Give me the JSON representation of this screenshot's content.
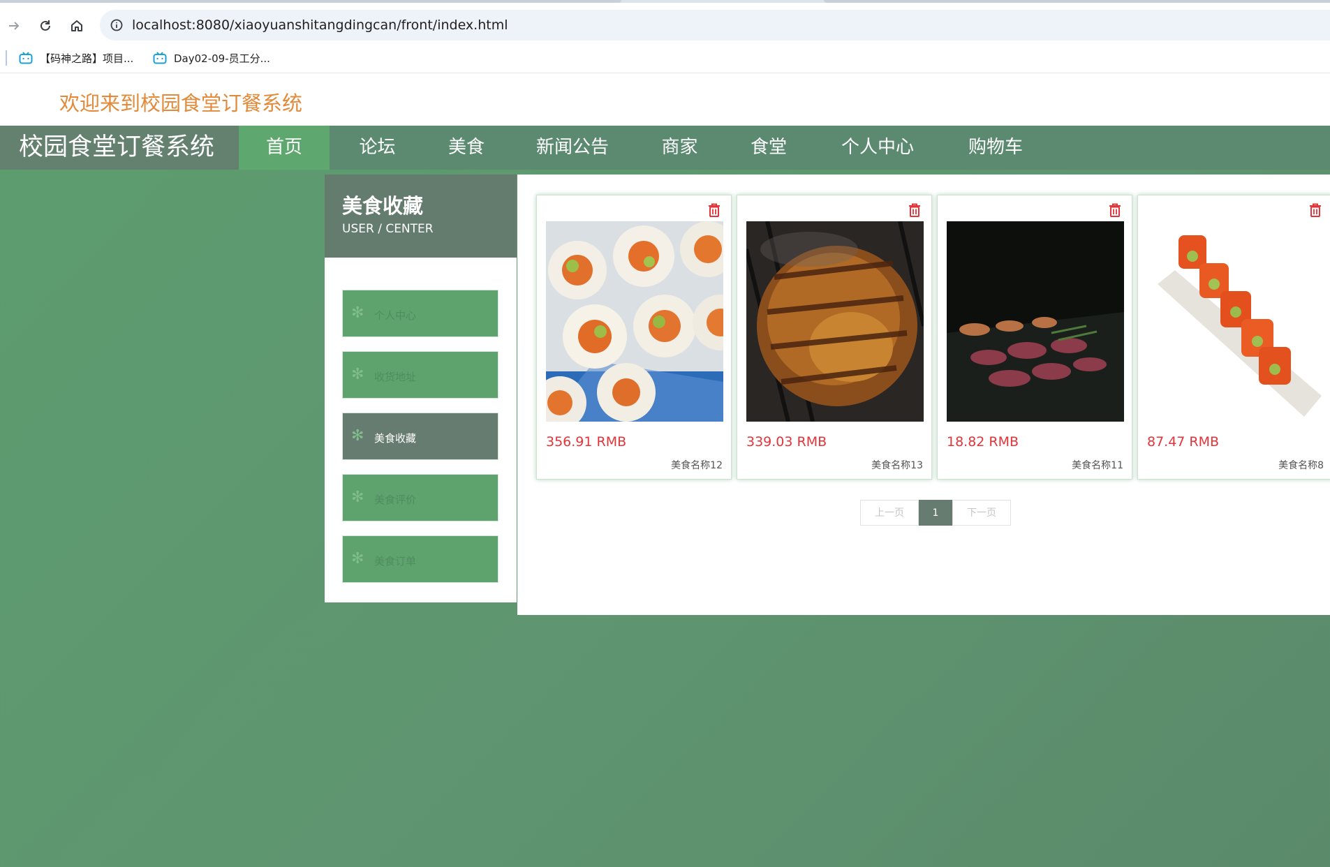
{
  "browser": {
    "url": "localhost:8080/xiaoyuanshitangdingcan/front/index.html",
    "bookmarks": [
      "【码神之路】项目...",
      "Day02-09-员工分..."
    ]
  },
  "header": {
    "welcome": "欢迎来到校园食堂订餐系统",
    "brand": "校园食堂订餐系统"
  },
  "nav": {
    "items": [
      {
        "label": "首页",
        "active": true
      },
      {
        "label": "论坛"
      },
      {
        "label": "美食"
      },
      {
        "label": "新闻公告"
      },
      {
        "label": "商家"
      },
      {
        "label": "食堂"
      },
      {
        "label": "个人中心"
      },
      {
        "label": "购物车"
      }
    ]
  },
  "sidebar": {
    "title": "美食收藏",
    "subtitle": "USER / CENTER",
    "items": [
      {
        "label": "个人中心"
      },
      {
        "label": "收货地址"
      },
      {
        "label": "美食收藏",
        "active": true
      },
      {
        "label": "美食评价"
      },
      {
        "label": "美食订单"
      }
    ]
  },
  "favorites": [
    {
      "price": "356.91 RMB",
      "name": "美食名称12",
      "image": "sushi-rolls"
    },
    {
      "price": "339.03 RMB",
      "name": "美食名称13",
      "image": "grilled-meat"
    },
    {
      "price": "18.82 RMB",
      "name": "美食名称11",
      "image": "meat-on-grill"
    },
    {
      "price": "87.47 RMB",
      "name": "美食名称8",
      "image": "salmon-sushi-plate"
    }
  ],
  "pager": {
    "prev": "上一页",
    "current": "1",
    "next": "下一页"
  },
  "colors": {
    "brand_bar": "#5b8a70",
    "accent_green": "#5ea76e",
    "active_gray": "#667c70",
    "price_red": "#e3343a",
    "welcome_orange": "#e28a3a"
  }
}
